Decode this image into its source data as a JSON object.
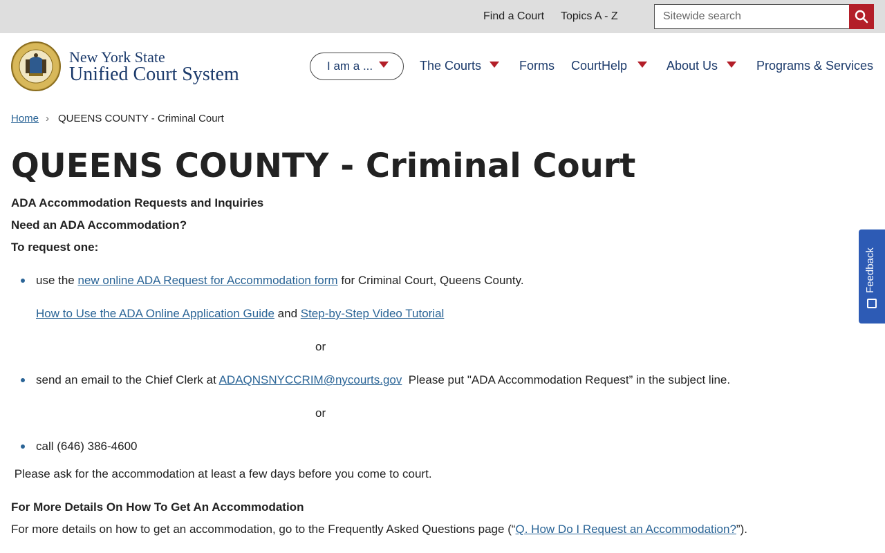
{
  "topbar": {
    "find_court": "Find a Court",
    "topics": "Topics A - Z",
    "search_placeholder": "Sitewide search"
  },
  "header": {
    "brand_line1": "New York State",
    "brand_line2": "Unified Court System",
    "iam_label": "I am a ...",
    "nav": {
      "courts": "The Courts",
      "forms": "Forms",
      "courthelp": "CourtHelp",
      "about": "About Us",
      "programs": "Programs & Services"
    }
  },
  "breadcrumb": {
    "home": "Home",
    "current": "QUEENS COUNTY - Criminal Court"
  },
  "page": {
    "title": "QUEENS COUNTY - Criminal Court",
    "ada_heading": "ADA Accommodation Requests and Inquiries",
    "need_heading": "Need an ADA Accommodation?",
    "request_heading": "To request one:",
    "b1_pre": "use the ",
    "b1_link": "new online ADA Request for Accommodation form",
    "b1_post": " for Criminal Court, Queens County.",
    "guide_link": "How to Use the ADA Online Application Guide",
    "and": " and ",
    "video_link": "Step-by-Step Video Tutorial",
    "or1": "or",
    "b2_pre": "send an email to the Chief Clerk at ",
    "b2_email": "ADAQNSNYCCRIM@nycourts.gov",
    "b2_post": "  Please put \"ADA Accommodation Request” in the subject line.",
    "or2": "or",
    "b3": "call (646) 386-4600",
    "advance_note": " Please ask for the accommodation at least a few days before you come to court.",
    "details_heading": "For More Details On How To Get An Accommodation",
    "details_pre": "For more details on how to get an accommodation, go to the Frequently Asked Questions page (“",
    "details_link": "Q. How Do I Request an Accommodation?",
    "details_post": "”)."
  },
  "feedback": {
    "label": "Feedback"
  },
  "colors": {
    "accent": "#b31e28",
    "link": "#2a6496",
    "navy": "#1b3a6b",
    "feedback_bg": "#2d5bb5"
  },
  "icons": {
    "search": "search-icon",
    "seal": "state-seal-logo",
    "caret": "caret-down-icon"
  }
}
